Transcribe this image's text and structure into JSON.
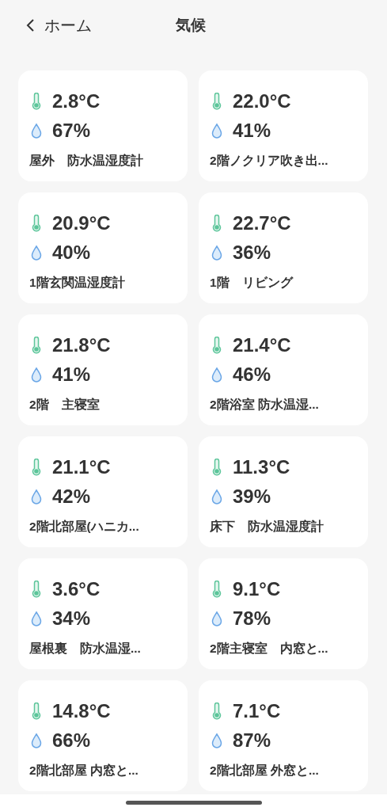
{
  "header": {
    "back_label": "ホーム",
    "title": "気候"
  },
  "sensors": [
    {
      "temperature": "2.8°C",
      "humidity": "67%",
      "name": "屋外　防水温湿度計"
    },
    {
      "temperature": "22.0°C",
      "humidity": "41%",
      "name": "2階ノクリア吹き出..."
    },
    {
      "temperature": "20.9°C",
      "humidity": "40%",
      "name": "1階玄関温湿度計"
    },
    {
      "temperature": "22.7°C",
      "humidity": "36%",
      "name": "1階　リビング"
    },
    {
      "temperature": "21.8°C",
      "humidity": "41%",
      "name": "2階　主寝室"
    },
    {
      "temperature": "21.4°C",
      "humidity": "46%",
      "name": "2階浴室 防水温湿..."
    },
    {
      "temperature": "21.1°C",
      "humidity": "42%",
      "name": "2階北部屋(ハニカ..."
    },
    {
      "temperature": "11.3°C",
      "humidity": "39%",
      "name": "床下　防水温湿度計"
    },
    {
      "temperature": "3.6°C",
      "humidity": "34%",
      "name": "屋根裏　防水温湿..."
    },
    {
      "temperature": "9.1°C",
      "humidity": "78%",
      "name": "2階主寝室　内窓と..."
    },
    {
      "temperature": "14.8°C",
      "humidity": "66%",
      "name": "2階北部屋 内窓と..."
    },
    {
      "temperature": "7.1°C",
      "humidity": "87%",
      "name": "2階北部屋 外窓と..."
    }
  ]
}
